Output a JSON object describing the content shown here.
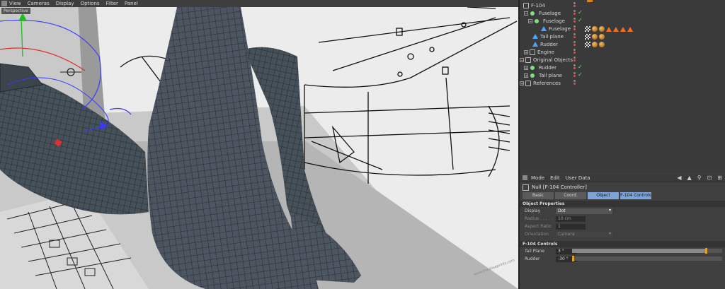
{
  "viewport": {
    "menu": [
      "View",
      "Cameras",
      "Display",
      "Options",
      "Filter",
      "Panel"
    ],
    "label": "Perspective"
  },
  "object_manager": {
    "rows": [
      {
        "name": "F-104",
        "icon": "null-icon",
        "depth": 0
      },
      {
        "name": "Fuselage",
        "icon": "green-dot-icon",
        "depth": 1
      },
      {
        "name": "Fuselage",
        "icon": "green-dot-icon",
        "depth": 2
      },
      {
        "name": "Fuselage",
        "icon": "polygon-icon",
        "depth": 3
      },
      {
        "name": "Tail plane",
        "icon": "polygon-icon",
        "depth": 1
      },
      {
        "name": "Rudder",
        "icon": "polygon-icon",
        "depth": 1
      },
      {
        "name": "Engine",
        "icon": "null-icon",
        "depth": 1
      },
      {
        "name": "Original Objects",
        "icon": "null-icon",
        "depth": 0
      },
      {
        "name": "Rudder",
        "icon": "green-dot-icon",
        "depth": 1
      },
      {
        "name": "Tail plane",
        "icon": "green-dot-icon",
        "depth": 1
      },
      {
        "name": "References",
        "icon": "null-icon",
        "depth": 0
      }
    ]
  },
  "attribute_manager": {
    "menu": [
      "Mode",
      "Edit",
      "User Data"
    ],
    "title": "Null [F-104 Controller]",
    "tabs": [
      "Basic",
      "Coord.",
      "Object",
      "F-104 Controls"
    ],
    "active_tabs": [
      "Object",
      "F-104 Controls"
    ],
    "object_properties": {
      "header": "Object Properties",
      "display_label": "Display",
      "display_value": "Dot",
      "radius_label": "Radius . . . . .",
      "radius_value": "10 cm",
      "aspect_label": "Aspect Ratio",
      "aspect_value": "1",
      "orientation_label": "Orientation",
      "orientation_value": "Camera"
    },
    "controls": {
      "header": "F-104 Controls",
      "tail_plane_label": "Tail Plane",
      "tail_plane_value": "3 °",
      "tail_plane_fraction": 0.9,
      "rudder_label": "Rudder",
      "rudder_value": "-30 °",
      "rudder_fraction": 0.0
    }
  },
  "colors": {
    "active_tab": "#7da3d8",
    "slider_knob": "#e0a020",
    "check_green": "#6de06d"
  }
}
